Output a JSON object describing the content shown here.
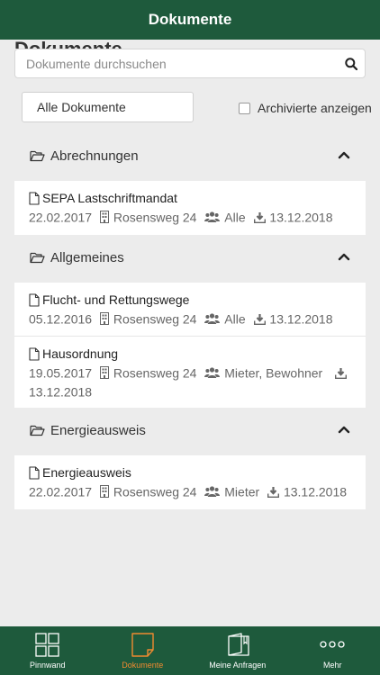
{
  "header": {
    "title": "Dokumente"
  },
  "search": {
    "placeholder": "Dokumente durchsuchen",
    "value": ""
  },
  "filter": {
    "selected": "Alle Dokumente"
  },
  "archive": {
    "label": "Archivierte anzeigen",
    "checked": false
  },
  "groups": [
    {
      "title": "Abrechnungen",
      "docs": [
        {
          "name": "SEPA Lastschriftmandat",
          "date": "22.02.2017",
          "property": "Rosensweg 24",
          "audience": "Alle",
          "download_date": "13.12.2018"
        }
      ]
    },
    {
      "title": "Allgemeines",
      "docs": [
        {
          "name": "Flucht- und Rettungswege",
          "date": "05.12.2016",
          "property": "Rosensweg 24",
          "audience": "Alle",
          "download_date": "13.12.2018"
        },
        {
          "name": "Hausordnung",
          "date": "19.05.2017",
          "property": "Rosensweg 24",
          "audience": "Mieter, Bewohner",
          "download_date": "13.12.2018"
        }
      ]
    },
    {
      "title": "Energieausweis",
      "docs": [
        {
          "name": "Energieausweis",
          "date": "22.02.2017",
          "property": "Rosensweg 24",
          "audience": "Mieter",
          "download_date": "13.12.2018"
        }
      ]
    }
  ],
  "tabbar": {
    "tabs": [
      {
        "label": "Pinnwand",
        "icon": "grid-icon",
        "active": false
      },
      {
        "label": "Dokumente",
        "icon": "document-icon",
        "active": true
      },
      {
        "label": "Meine Anfragen",
        "icon": "book-icon",
        "active": false
      },
      {
        "label": "Mehr",
        "icon": "more-dots-icon",
        "active": false
      }
    ]
  },
  "colors": {
    "brand": "#1e5a3c",
    "accent": "#f08a30",
    "background": "#ececec"
  }
}
